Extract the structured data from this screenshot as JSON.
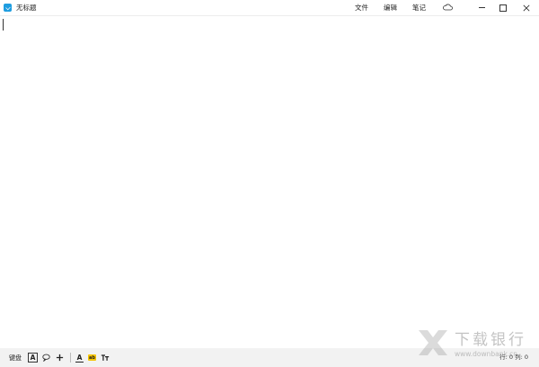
{
  "window": {
    "title": "无标题",
    "app_icon": "notepad-app-icon",
    "accent_color": "#1e9de0"
  },
  "menu": {
    "file": "文件",
    "edit": "编辑",
    "notes": "笔记",
    "cloud_icon": "cloud-icon"
  },
  "editor": {
    "content": ""
  },
  "statusbar": {
    "keyboard_label": "键盘",
    "font_button": "A",
    "comment_icon": "speech-bubble-icon",
    "add_icon": "plus-icon",
    "text_color_button": "A",
    "highlight_button": "ab",
    "text_size_icon": "text-size-icon",
    "position_text": "行: 0  列: 0"
  },
  "watermark": {
    "title": "下载银行",
    "url": "www.downbank.cn"
  }
}
